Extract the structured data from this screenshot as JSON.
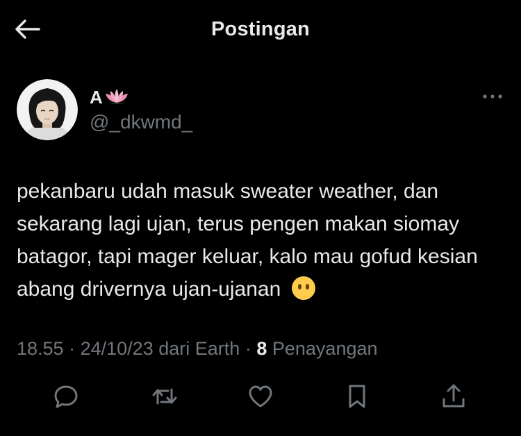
{
  "header": {
    "title": "Postingan",
    "back_icon": "arrow-left-icon"
  },
  "post": {
    "author": {
      "display_name": "A",
      "name_emoji": "lotus-icon",
      "handle": "@_dkwmd_",
      "avatar": "avatar"
    },
    "text": "pekanbaru udah masuk sweater weather, dan sekarang lagi ujan, terus pengen makan siomay batagor, tapi mager keluar, kalo mau gofud kesian abang drivernya ujan-ujanan",
    "text_emoji": "face-without-mouth-icon",
    "meta": {
      "time": "18.55",
      "date": "24/10/23",
      "source": "dari Earth",
      "separator": "·",
      "views_count": "8",
      "views_label": "Penayangan"
    }
  },
  "actions": {
    "icons": [
      "reply-icon",
      "repost-icon",
      "like-icon",
      "bookmark-icon",
      "share-icon"
    ]
  },
  "colors": {
    "background": "#000000",
    "text_primary": "#e7e9ea",
    "text_secondary": "#71767b"
  }
}
